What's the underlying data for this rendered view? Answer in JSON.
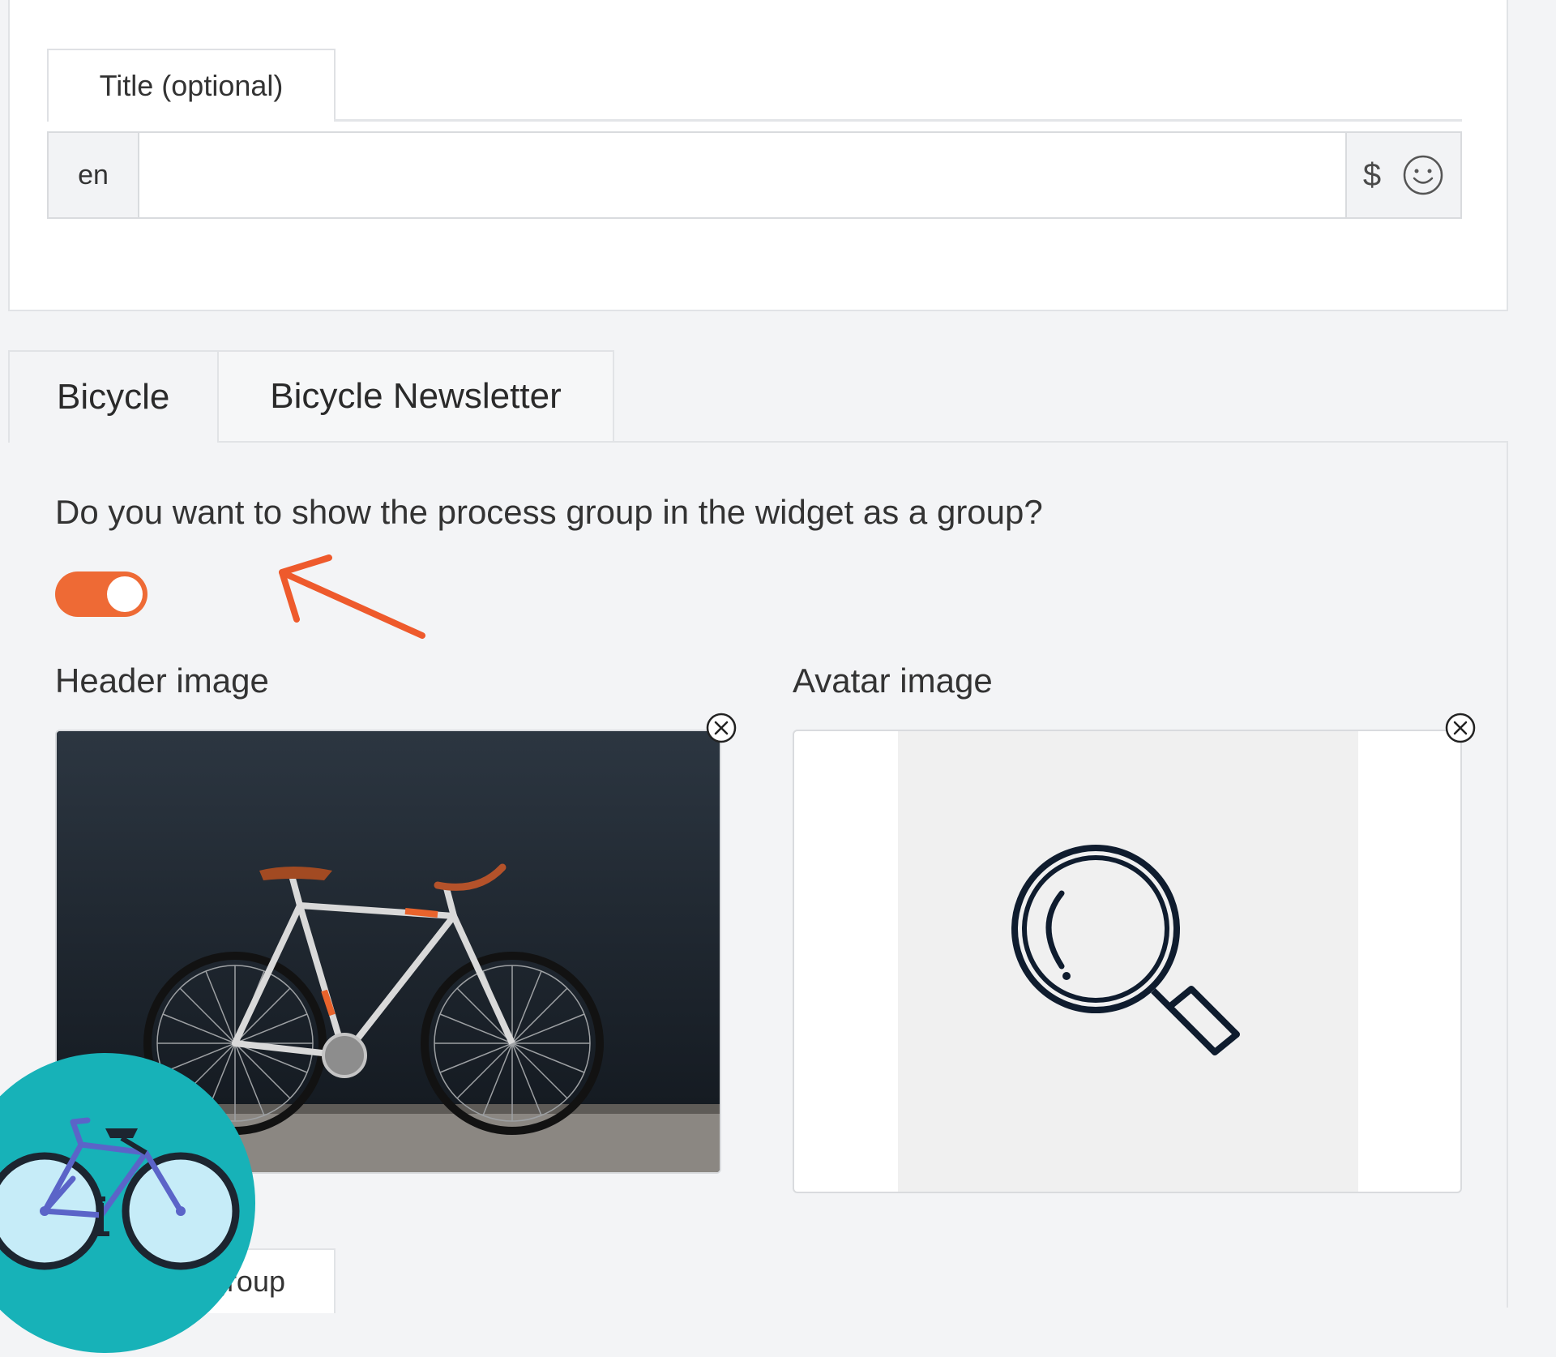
{
  "title_section": {
    "tab_label": "Title (optional)",
    "language": "en",
    "input_value": "",
    "currency_symbol": "$",
    "emoji_icon": "smiley-icon"
  },
  "tabs": [
    {
      "label": "Bicycle",
      "active": true
    },
    {
      "label": "Bicycle Newsletter",
      "active": false
    }
  ],
  "question": "Do you want to show the process group in the widget as a group?",
  "toggle": {
    "on": true,
    "color": "#ee6a35"
  },
  "header_image": {
    "label": "Header image",
    "remove_icon": "close-circle-icon"
  },
  "avatar_image": {
    "label": "Avatar image",
    "remove_icon": "close-circle-icon",
    "placeholder_icon": "magnifier-icon"
  },
  "bottom_tab": {
    "label": "group"
  },
  "colors": {
    "accent": "#ee6a35",
    "badge": "#17b2b8",
    "bike_frame": "#5b64c8",
    "wheel_fill": "#c6ecf8"
  }
}
